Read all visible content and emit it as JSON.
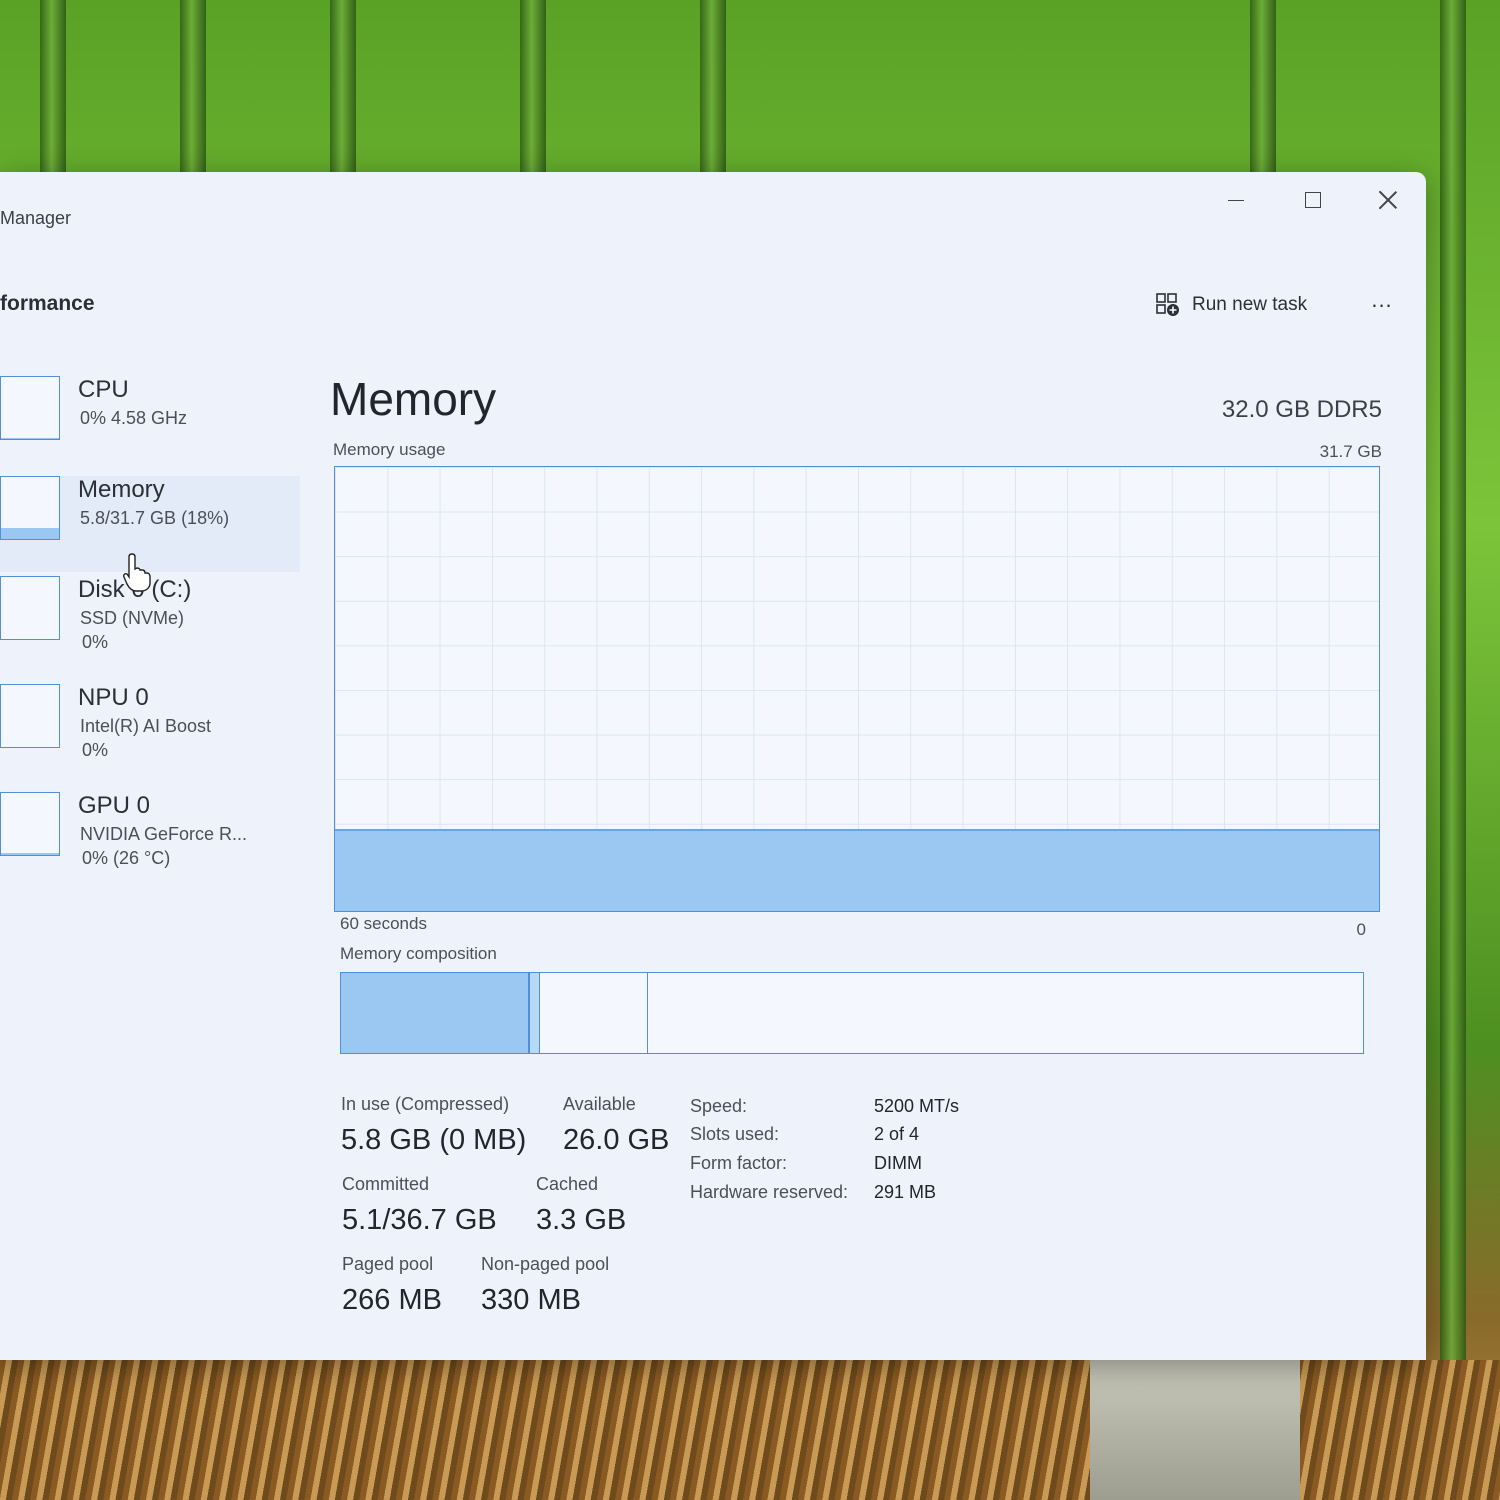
{
  "window": {
    "app_title": "Manager",
    "section_title": "formance"
  },
  "header": {
    "run_new_task": "Run new task",
    "more": "..."
  },
  "sidebar": {
    "items": [
      {
        "name": "CPU",
        "line1": "0%  4.58 GHz",
        "line2": "",
        "fill": 0.02
      },
      {
        "name": "Memory",
        "line1": "5.8/31.7 GB (18%)",
        "line2": "",
        "fill": 0.18
      },
      {
        "name": "Disk 0 (C:)",
        "line1": "SSD (NVMe)",
        "line2": "0%",
        "fill": 0
      },
      {
        "name": "NPU 0",
        "line1": "Intel(R) AI Boost",
        "line2": "0%",
        "fill": 0
      },
      {
        "name": "GPU 0",
        "line1": "NVIDIA GeForce R...",
        "line2": "0%  (26 °C)",
        "fill": 0.03
      }
    ]
  },
  "memory": {
    "title": "Memory",
    "spec": "32.0 GB DDR5",
    "usage_label": "Memory usage",
    "usage_max": "31.7 GB",
    "usage_fraction": 0.18,
    "time_left": "60 seconds",
    "time_right": "0",
    "composition_label": "Memory composition",
    "composition": {
      "in_use_gb": 5.8,
      "modified_gb": 0.3,
      "standby_gb": 3.3,
      "total_gb": 31.7
    },
    "stats": {
      "in_use_label": "In use (Compressed)",
      "in_use_value": "5.8 GB (0 MB)",
      "available_label": "Available",
      "available_value": "26.0 GB",
      "committed_label": "Committed",
      "committed_value": "5.1/36.7 GB",
      "cached_label": "Cached",
      "cached_value": "3.3 GB",
      "paged_label": "Paged pool",
      "paged_value": "266 MB",
      "nonpaged_label": "Non-paged pool",
      "nonpaged_value": "330 MB"
    },
    "info": {
      "speed_key": "Speed:",
      "speed_val": "5200 MT/s",
      "slots_key": "Slots used:",
      "slots_val": "2 of 4",
      "form_key": "Form factor:",
      "form_val": "DIMM",
      "hw_key": "Hardware reserved:",
      "hw_val": "291 MB"
    }
  },
  "colors": {
    "accent": "#4f8fd9",
    "fill": "#9bc7f3",
    "window_bg": "#eef3fb"
  }
}
